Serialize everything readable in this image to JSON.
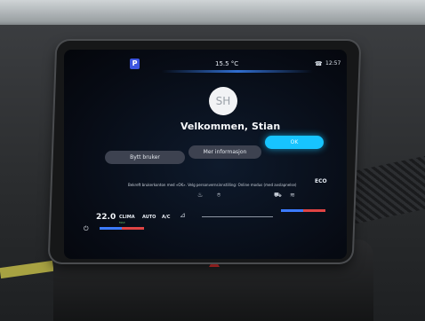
{
  "status": {
    "parking_badge": "P",
    "temperature": "15.5 °C",
    "time": "12:57",
    "phone_icon": "phone-signal-icon"
  },
  "profile": {
    "avatar_initials": "SH",
    "welcome": "Velkommen, Stian"
  },
  "buttons": {
    "switch_user": "Bytt bruker",
    "more_info": "Mer informasjon",
    "ok": "OK"
  },
  "info_text": "Bekreft brukerkonton med «OK». Velg personvernsinnstilling: Online modus (med avslapnelse)",
  "drive_mode": "ECO",
  "climate": {
    "temperature": "22.0",
    "clima_label": "CLIMA",
    "clima_sub": "MAX",
    "auto_label": "AUTO",
    "ac_label": "A/C"
  },
  "colors": {
    "accent": "#17c4ff",
    "parking": "#3d55e0",
    "heat": "#e04444",
    "cool": "#3c7bff"
  }
}
